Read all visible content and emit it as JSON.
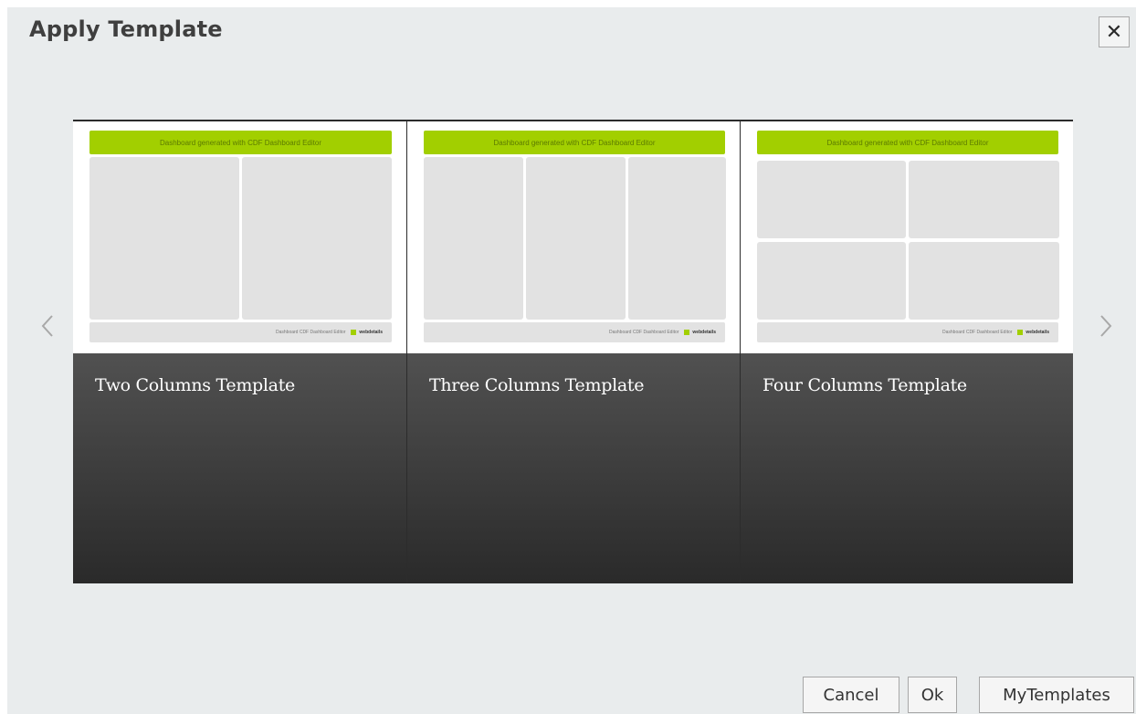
{
  "dialog": {
    "title": "Apply Template",
    "close_symbol": "✕"
  },
  "carousel": {
    "prev_icon": "chevron-left-icon",
    "next_icon": "chevron-right-icon",
    "templates": [
      {
        "label": "Two Columns Template",
        "thumb_header": "Dashboard generated with CDF Dashboard Editor",
        "thumb_footer": "Dashboard CDF Dashboard Editor",
        "thumb_logo": "webdetails"
      },
      {
        "label": "Three Columns Template",
        "thumb_header": "Dashboard generated with CDF Dashboard Editor",
        "thumb_footer": "Dashboard CDF Dashboard Editor",
        "thumb_logo": "webdetails"
      },
      {
        "label": "Four Columns Template",
        "thumb_header": "Dashboard generated with CDF Dashboard Editor",
        "thumb_footer": "Dashboard CDF Dashboard Editor",
        "thumb_logo": "webdetails"
      }
    ]
  },
  "buttons": {
    "cancel": "Cancel",
    "ok": "Ok",
    "my_templates": "MyTemplates"
  },
  "colors": {
    "dialog_bg": "#e9eced",
    "thumb_header": "#a2cf00",
    "card_gradient_top": "#5e5e5e",
    "card_gradient_bottom": "#2a2a2a"
  }
}
